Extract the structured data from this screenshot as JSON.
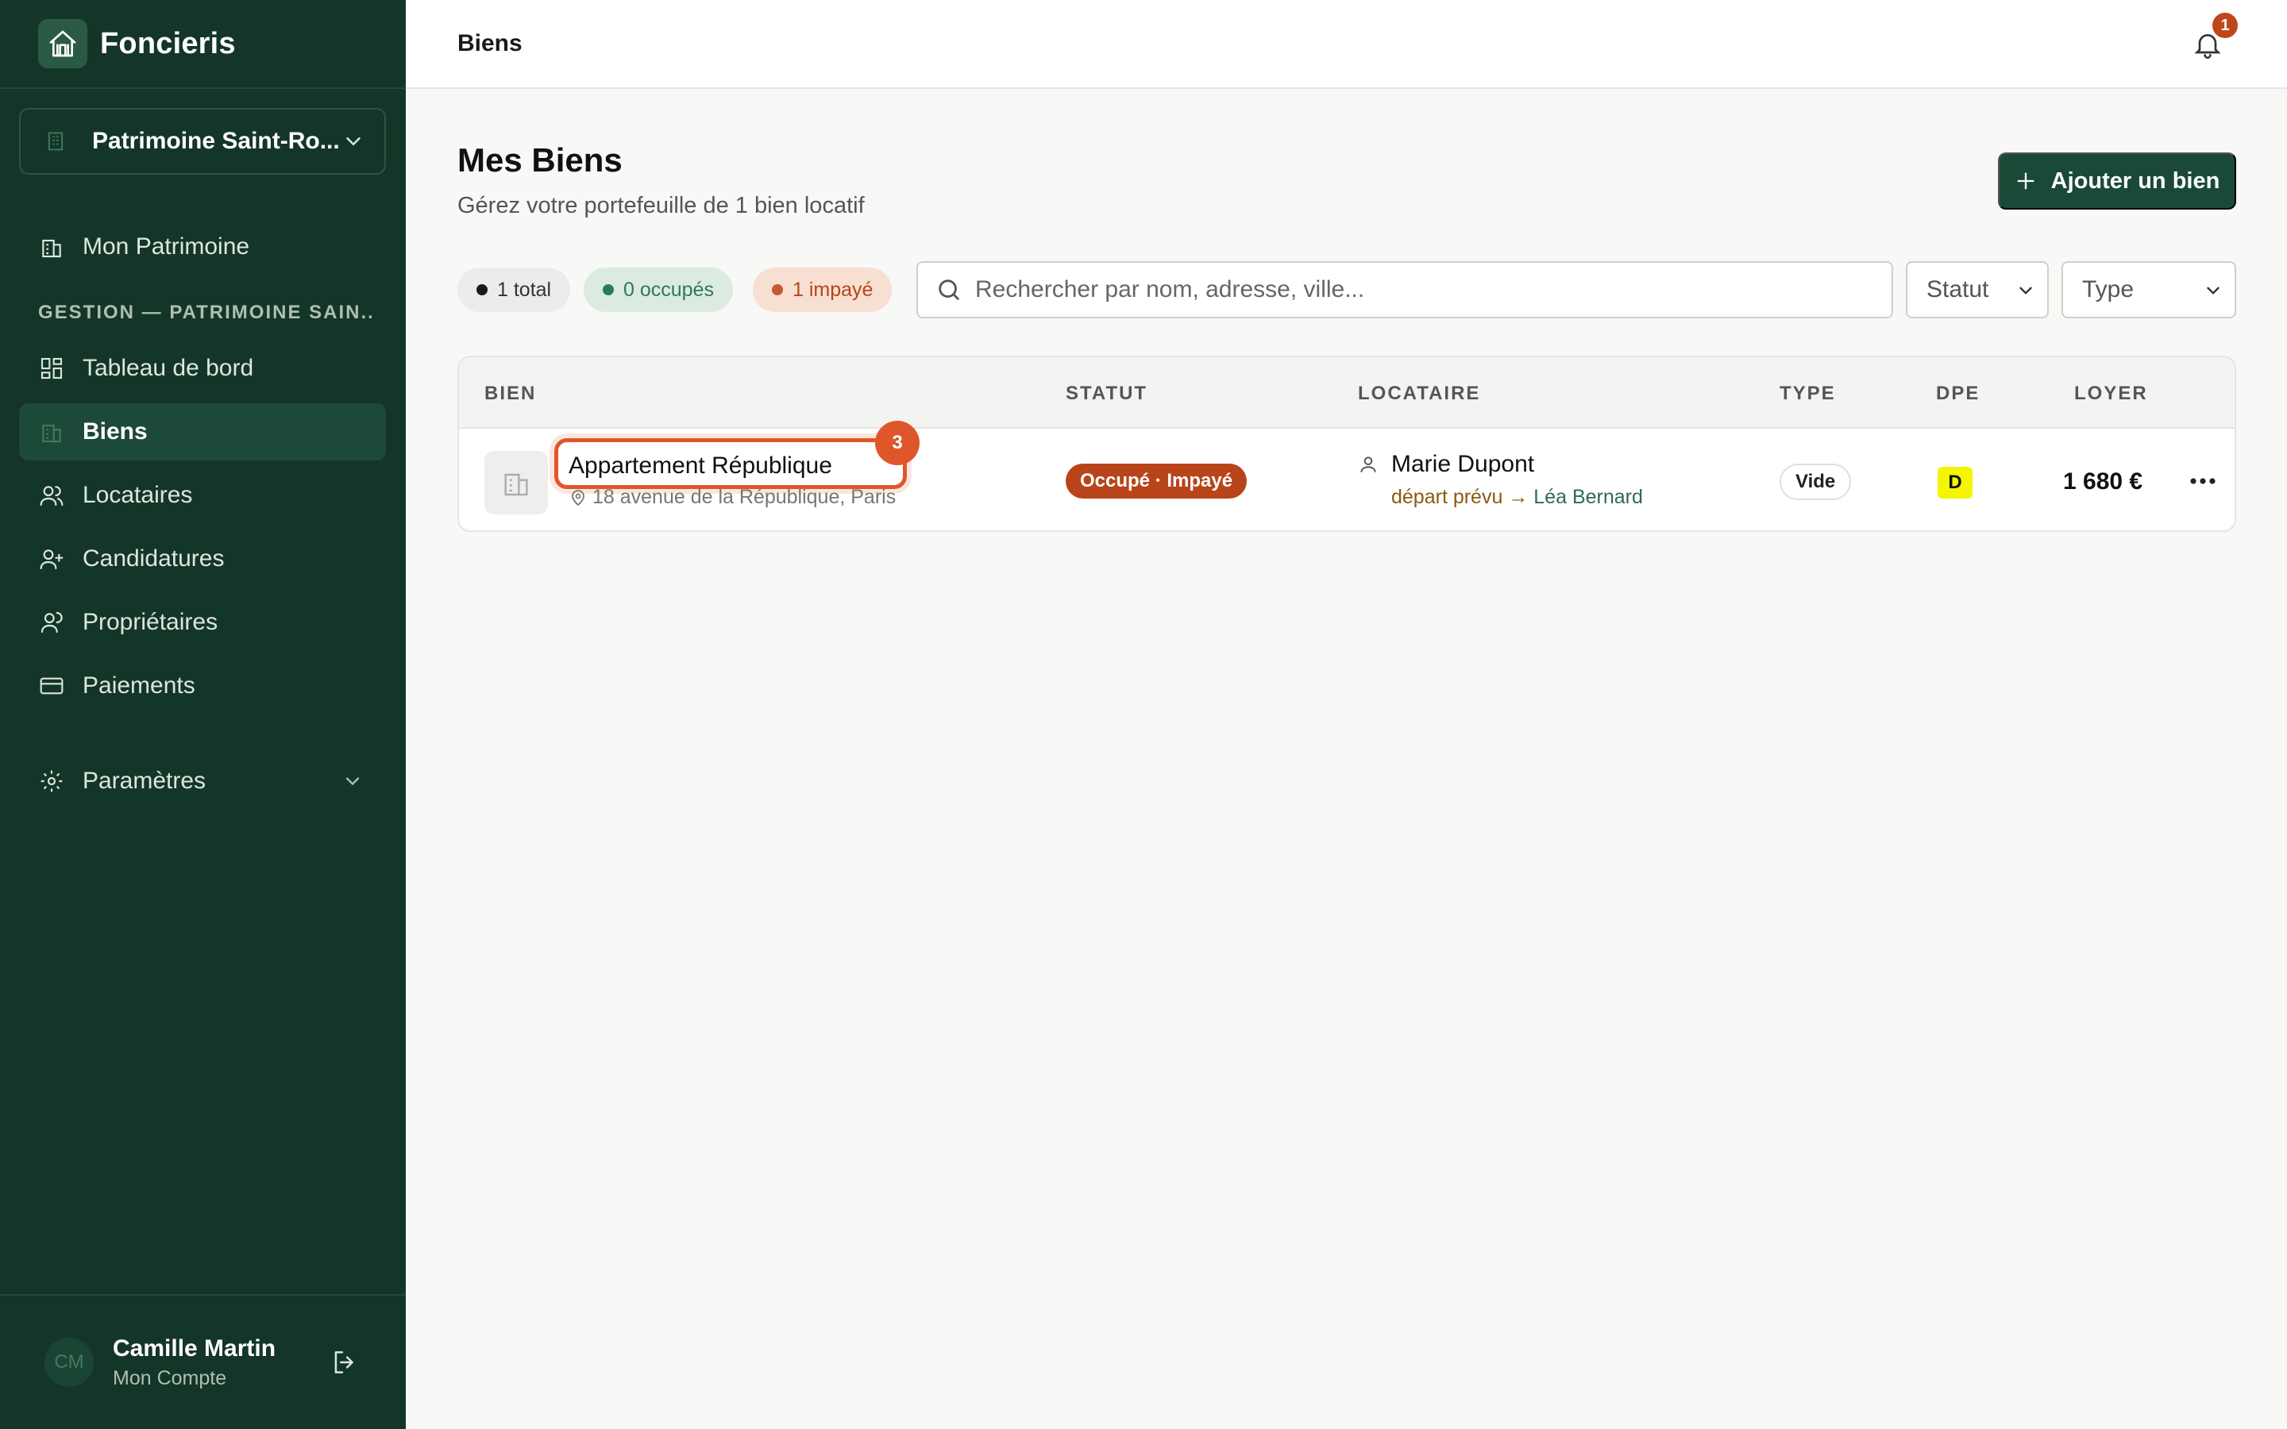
{
  "app": {
    "name": "Foncieris"
  },
  "org_selector": {
    "label": "Patrimoine Saint-Ro..."
  },
  "nav": {
    "patrimoine": "Mon Patrimoine",
    "section_label": "GESTION — PATRIMOINE SAIN...",
    "items": [
      {
        "label": "Tableau de bord",
        "icon": "dashboard-icon"
      },
      {
        "label": "Biens",
        "icon": "building-icon",
        "active": true
      },
      {
        "label": "Locataires",
        "icon": "users-icon"
      },
      {
        "label": "Candidatures",
        "icon": "user-plus-icon"
      },
      {
        "label": "Propriétaires",
        "icon": "owners-icon"
      },
      {
        "label": "Paiements",
        "icon": "credit-card-icon"
      }
    ],
    "settings": "Paramètres"
  },
  "user": {
    "initials": "CM",
    "name": "Camille Martin",
    "subtitle": "Mon Compte"
  },
  "topbar": {
    "title": "Biens",
    "notification_count": "1"
  },
  "page": {
    "title": "Mes Biens",
    "subtitle": "Gérez votre portefeuille de 1 bien locatif",
    "add_button": "Ajouter un bien"
  },
  "filters": {
    "chips": {
      "total": "1 total",
      "occupied": "0 occupés",
      "unpaid": "1 impayé"
    },
    "search_placeholder": "Rechercher par nom, adresse, ville...",
    "status_select": "Statut",
    "type_select": "Type"
  },
  "table": {
    "headers": {
      "bien": "BIEN",
      "statut": "STATUT",
      "locataire": "LOCATAIRE",
      "type": "TYPE",
      "dpe": "DPE",
      "loyer": "LOYER"
    },
    "rows": [
      {
        "name": "Appartement République",
        "address": "18 avenue de la République, Paris",
        "status": "Occupé · Impayé",
        "tenant": "Marie Dupont",
        "tenant_note_prefix": "départ prévu",
        "tenant_note_arrow": "→",
        "tenant_note_next": "Léa Bernard",
        "type": "Vide",
        "dpe": "D",
        "rent": "1 680 €"
      }
    ]
  },
  "annotation": {
    "marker": "3"
  },
  "colors": {
    "sidebar": "#143629",
    "accent": "#1a4a37",
    "danger": "#b8441a",
    "marker": "#e0562b",
    "dpe_d": "#f5f500"
  }
}
